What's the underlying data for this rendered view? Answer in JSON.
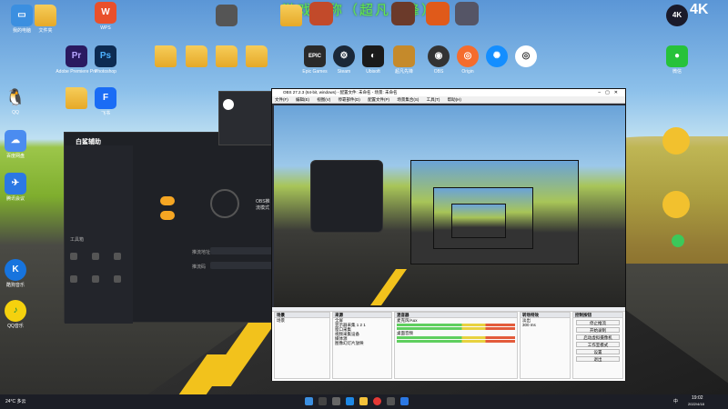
{
  "watermark": "游戏名称（超凡先锋）",
  "brand_corner": "4K",
  "desktop_icons": [
    {
      "label": "我的电脑",
      "abbr": "",
      "color": "#3b8fe0"
    },
    {
      "label": "文件夹",
      "abbr": "",
      "color": "folder"
    },
    {
      "label": "WPS",
      "abbr": "W",
      "color": "#e9502b"
    },
    {
      "label": "Adobe Premiere Pro",
      "abbr": "Pr",
      "color": "#2a1a60"
    },
    {
      "label": "Photoshop",
      "abbr": "Ps",
      "color": "#0d2b52"
    },
    {
      "label": "QQ",
      "abbr": "Q",
      "color": "#222"
    },
    {
      "label": "百度网盘",
      "abbr": "",
      "color": "#4b8cf0"
    },
    {
      "label": "飞书",
      "abbr": "F",
      "color": "#1a6cf5"
    },
    {
      "label": "腾讯会议",
      "abbr": "",
      "color": "#2b78e4"
    },
    {
      "label": "酷狗音乐",
      "abbr": "K",
      "color": "#1774de"
    },
    {
      "label": "QQ音乐",
      "abbr": "",
      "color": "#f5d10e"
    },
    {
      "label": "Epic Games",
      "abbr": "EPIC",
      "color": "#2a2a2a"
    },
    {
      "label": "Steam",
      "abbr": "",
      "color": "#1b2838"
    },
    {
      "label": "Ubisoft",
      "abbr": "",
      "color": "#1a1a1a"
    },
    {
      "label": "超凡先锋",
      "abbr": "",
      "color": "#c58a2b"
    },
    {
      "label": "OBS",
      "abbr": "",
      "color": "#333"
    },
    {
      "label": "Origin",
      "abbr": "",
      "color": "#f56c2d"
    },
    {
      "label": "微信",
      "abbr": "",
      "color": "#27c23a"
    }
  ],
  "left_app": {
    "brand": "白鲨辅助",
    "mode": "OBS推流模式",
    "fields": [
      "推流地址",
      "推流码"
    ]
  },
  "obs": {
    "title": "OBS 27.2.3 (64-bit, windows) - 配置文件: 未命名 - 场景: 未命名",
    "menu": [
      "文件(F)",
      "编辑(E)",
      "视图(V)",
      "停靠部件(D)",
      "配置文件(P)",
      "场景集合(S)",
      "工具(T)",
      "帮助(H)"
    ],
    "panels": {
      "scenes": {
        "title": "场景",
        "items": [
          "场景"
        ]
      },
      "sources": {
        "title": "来源",
        "items": [
          "全屏",
          "显示器采集 1 2 1",
          "窗口采集",
          "视频采集设备",
          "媒体源",
          "图像幻灯片放映"
        ]
      },
      "mixer": {
        "title": "混音器",
        "items": [
          "麦克风/Aux",
          "桌面音频"
        ]
      },
      "transitions": {
        "title": "转场特效",
        "mode": "淡出",
        "duration": "300 ms"
      },
      "controls": {
        "title": "控制按钮",
        "buttons": [
          "停止推流",
          "开始录制",
          "启动虚拟摄像机",
          "工作室模式",
          "设置",
          "退出"
        ]
      }
    },
    "status": "LIVE: 00:12:45  REC: 00:00:00  CPU: 3.8%, 60.00 fps"
  },
  "taskbar": {
    "weather": "24°C 多云",
    "clock": "19:02",
    "date": "2022/4/18",
    "lang": "中"
  }
}
